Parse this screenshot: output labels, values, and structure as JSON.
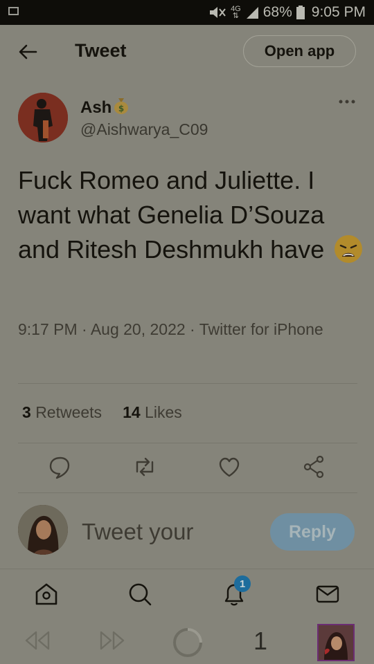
{
  "status_bar": {
    "network": "4G",
    "battery_percent": "68%",
    "time": "9:05 PM",
    "icons": [
      "gallery-icon",
      "mute-icon",
      "data-icon",
      "signal-icon",
      "battery-icon"
    ]
  },
  "header": {
    "title": "Tweet",
    "open_app_label": "Open app"
  },
  "tweet": {
    "author_name": "Ash",
    "author_emoji": "money-bag-icon",
    "author_handle": "@Aishwarya_C09",
    "text": "Fuck Romeo and Juliette. I want what Genelia D’Souza and Ritesh Deshmukh have",
    "text_emoji": "weary-face-icon",
    "meta": "9:17 PM · Aug 20, 2022 · Twitter for iPhone",
    "retweets_count": "3",
    "retweets_label": "Retweets",
    "likes_count": "14",
    "likes_label": "Likes"
  },
  "actions": [
    "reply-icon",
    "retweet-icon",
    "like-icon",
    "share-icon"
  ],
  "reply_box": {
    "placeholder": "Tweet your",
    "button_label": "Reply"
  },
  "bottom_nav": {
    "items": [
      "home-icon",
      "search-icon",
      "notifications-icon",
      "messages-icon"
    ],
    "notification_badge": "1"
  },
  "media_bar": {
    "count": "1"
  },
  "colors": {
    "background": "#85847a",
    "status_bar": "#0e0d09",
    "reply_button": "#6f8fa2",
    "badge": "#1d6c9c"
  }
}
